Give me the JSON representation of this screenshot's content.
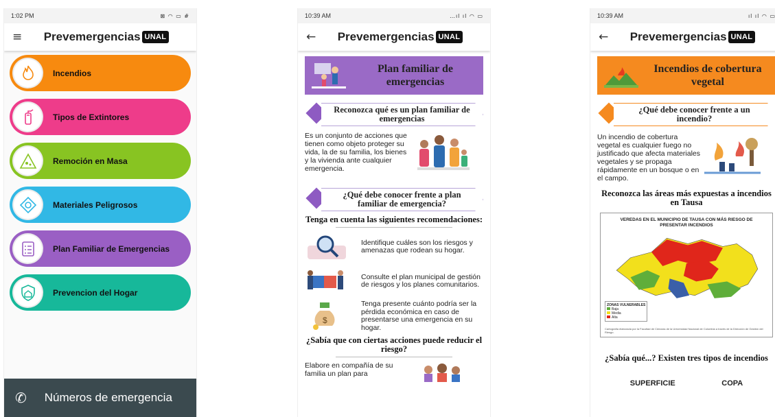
{
  "screen1": {
    "status": {
      "time": "1:02 PM",
      "icons": "⊠ ◠ ▭ #"
    },
    "appbar": {
      "brand": "Prevemergencias",
      "badge": "UNAL"
    },
    "menu": [
      {
        "label": "Incendios",
        "color": "#f78a0f",
        "icon": "fire-icon"
      },
      {
        "label": "Tipos de Extintores",
        "color": "#ee3c8a",
        "icon": "extinguisher-icon"
      },
      {
        "label": "Remoción en Masa",
        "color": "#88c422",
        "icon": "landslide-icon"
      },
      {
        "label": "Materiales Peligrosos",
        "color": "#31b8e5",
        "icon": "hazmat-icon"
      },
      {
        "label": "Plan Familiar de Emergencias",
        "color": "#9a5fc4",
        "icon": "checklist-icon"
      },
      {
        "label": "Prevencion del Hogar",
        "color": "#17b89a",
        "icon": "home-shield-icon"
      }
    ],
    "footer": {
      "label": "Números de emergencia"
    }
  },
  "screen2": {
    "status": {
      "time": "10:39 AM",
      "icons": "…ıl ıl ◠ ▭"
    },
    "appbar": {
      "brand": "Prevemergencias",
      "badge": "UNAL"
    },
    "banner": {
      "title": "Plan familiar de emergencias",
      "color": "#9a6ac6"
    },
    "tag1": "Reconozca qué es un plan familiar de emergencias",
    "intro": "Es un conjunto de acciones que tienen como objeto proteger su vida, la de su familia, los bienes y la vivienda ante cualquier emergencia.",
    "tag2": "¿Qué debe conocer frente a plan familiar de emergencia?",
    "recs_heading": "Tenga en cuenta las siguientes recomendaciones:",
    "recs": [
      "Identifique cuáles son los riesgos y amenazas que rodean su hogar.",
      "Consulte el plan municipal de gestión de riesgos y los planes comunitarios.",
      "Tenga presente cuánto podría ser la pérdida económica en caso de presentarse una emergencia en su hogar."
    ],
    "know_heading": "¿Sabía que con ciertas acciones puede reducir el riesgo?",
    "tail": "Elabore en compañía de su familia un plan para",
    "accent": "#8e5bc2"
  },
  "screen3": {
    "status": {
      "time": "10:39 AM",
      "icons": "ıl ıl ◠ ▭"
    },
    "appbar": {
      "brand": "Prevemergencias",
      "badge": "UNAL"
    },
    "banner": {
      "title": "Incendios de cobertura vegetal",
      "color": "#f58a1f"
    },
    "tag1": "¿Qué debe conocer frente a un incendio?",
    "intro": "Un incendio de cobertura vegetal es cualquier fuego no justificado que afecta materiales vegetales y se propaga rápidamente en un bosque o en el campo.",
    "areas_heading": "Reconozca las áreas más expuestas a incendios en Tausa",
    "map_title": "VEREDAS EN EL MUNICIPIO DE TAUSA CON MÁS RIESGO DE PRESENTAR INCENDIOS",
    "legend_title": "ZONAS VULNERABLES",
    "legend": [
      {
        "label": "Baja",
        "color": "#5fae3a"
      },
      {
        "label": "Media",
        "color": "#f2e01c"
      },
      {
        "label": "Alta",
        "color": "#e0261b"
      }
    ],
    "map_note": "Cartografía elaborada por la Facultad de Ciencias de la Universidad Nacional de Colombia a través de la Dirección de Gestión del Riesgo.",
    "types_heading": "¿Sabía qué...? Existen tres tipos de incendios",
    "types": [
      "SUPERFICIE",
      "COPA"
    ],
    "accent": "#f58a1f"
  }
}
